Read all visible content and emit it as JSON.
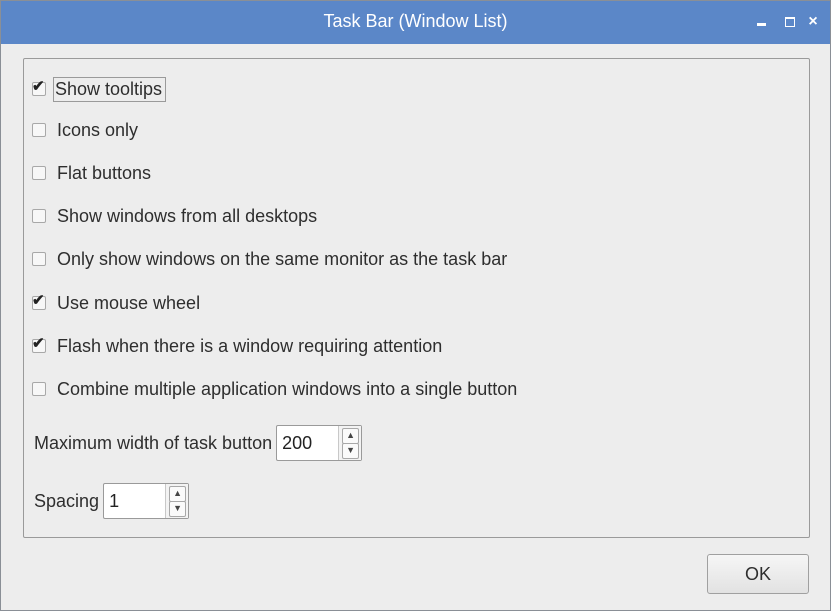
{
  "window": {
    "title": "Task Bar (Window List)",
    "controls": [
      "minimize-icon",
      "maximize-icon",
      "close-icon"
    ],
    "close_glyph": "×",
    "accent_color": "#5b87c8"
  },
  "options": [
    {
      "label": "Show tooltips",
      "checked": true,
      "focused": true
    },
    {
      "label": "Icons only",
      "checked": false
    },
    {
      "label": "Flat buttons",
      "checked": false
    },
    {
      "label": "Show windows from all desktops",
      "checked": false
    },
    {
      "label": "Only show windows on the same monitor as the task bar",
      "checked": false
    },
    {
      "label": "Use mouse wheel",
      "checked": true
    },
    {
      "label": "Flash when there is a window requiring attention",
      "checked": true
    },
    {
      "label": "Combine multiple application windows into a single button",
      "checked": false
    }
  ],
  "check_glyph": "✔",
  "max_width": {
    "label": "Maximum width of task button",
    "value": "200"
  },
  "spacing": {
    "label": "Spacing",
    "value": "1"
  },
  "spin_up_glyph": "▲",
  "spin_down_glyph": "▼",
  "ok_label": "OK"
}
